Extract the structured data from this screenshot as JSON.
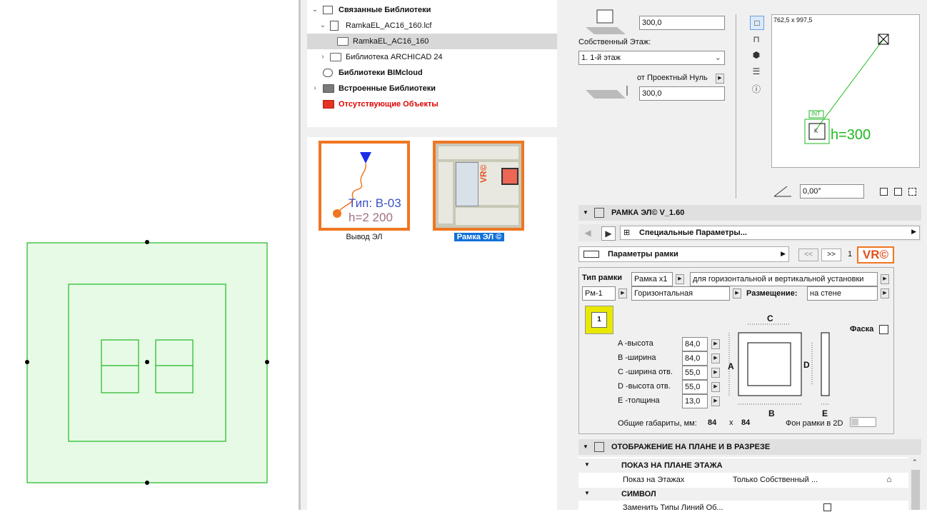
{
  "tree": {
    "items": [
      {
        "label": "Связанные Библиотеки",
        "bold": true
      },
      {
        "label": "RamkaEL_AC16_160.lcf",
        "bold": false
      },
      {
        "label": "RamkaEL_AC16_160",
        "bold": false
      },
      {
        "label": "Библиотека ARCHICAD 24",
        "bold": false
      },
      {
        "label": "Библиотеки BIMcloud",
        "bold": true
      },
      {
        "label": "Встроенные Библиотеки",
        "bold": true
      },
      {
        "label": "Отсутствующие Объекты",
        "bold": true,
        "color": "#e00000"
      }
    ]
  },
  "thumbnails": [
    {
      "caption": "Вывод ЭЛ",
      "type_text": "Тип: В-03",
      "h_text": "h=2 200"
    },
    {
      "caption": "Рамка ЭЛ ©",
      "selected": true,
      "badge": "VR©"
    }
  ],
  "top": {
    "height_value": "300,0",
    "own_floor_label": "Собственный Этаж:",
    "floor_select": "1. 1-й этаж",
    "ref_label": "от Проектный Нуль",
    "offset_value": "300,0",
    "angle_value": "0,00°",
    "preview_size": "762,5 x 997,5",
    "preview_int": "INT",
    "preview_k": "K",
    "preview_h": "h=300"
  },
  "object_header": {
    "title": "РАМКА ЭЛ© V_1.60"
  },
  "nav": {
    "label": "Специальные Параметры..."
  },
  "params": {
    "header_label": "Параметры рамки",
    "prev": "<<",
    "next": ">>",
    "page": "1",
    "logo": "VR©",
    "type_label": "Тип рамки",
    "type_value": "Рамка х1",
    "install_value": "для горизонтальной и вертикальной установки",
    "code_value": "Рм-1",
    "orientation_value": "Горизонтальная",
    "placement_label": "Размещение:",
    "placement_value": "на стене",
    "chamfer_label": "Фаска",
    "badge_num": "1",
    "rows": [
      {
        "label": "A -высота",
        "value": "84,0"
      },
      {
        "label": "B -ширина",
        "value": "84,0"
      },
      {
        "label": "C -ширина отв.",
        "value": "55,0"
      },
      {
        "label": "D -высота отв.",
        "value": "55,0"
      },
      {
        "label": "E -толщина",
        "value": "13,0"
      }
    ],
    "dim_labels": {
      "a": "A",
      "b": "B",
      "c": "C",
      "d": "D",
      "e": "E"
    },
    "overall_label": "Общие габариты, мм:",
    "overall_w": "84",
    "overall_x": "x",
    "overall_h": "84",
    "bg_label": "Фон рамки в 2D"
  },
  "section2": {
    "title": "ОТОБРАЖЕНИЕ НА ПЛАНЕ И В РАЗРЕЗЕ",
    "sub1": "ПОКАЗ НА ПЛАНЕ ЭТАЖА",
    "row1_label": "Показ на Этажах",
    "row1_value": "Только Собственный ...",
    "sub2": "СИМВОЛ",
    "row2_label": "Заменить Типы Линий Об..."
  },
  "colors": {
    "accent_orange": "#f07621",
    "canvas_fill": "#e6fae6",
    "canvas_stroke": "#1fb81f",
    "selection": "#1170d8"
  }
}
